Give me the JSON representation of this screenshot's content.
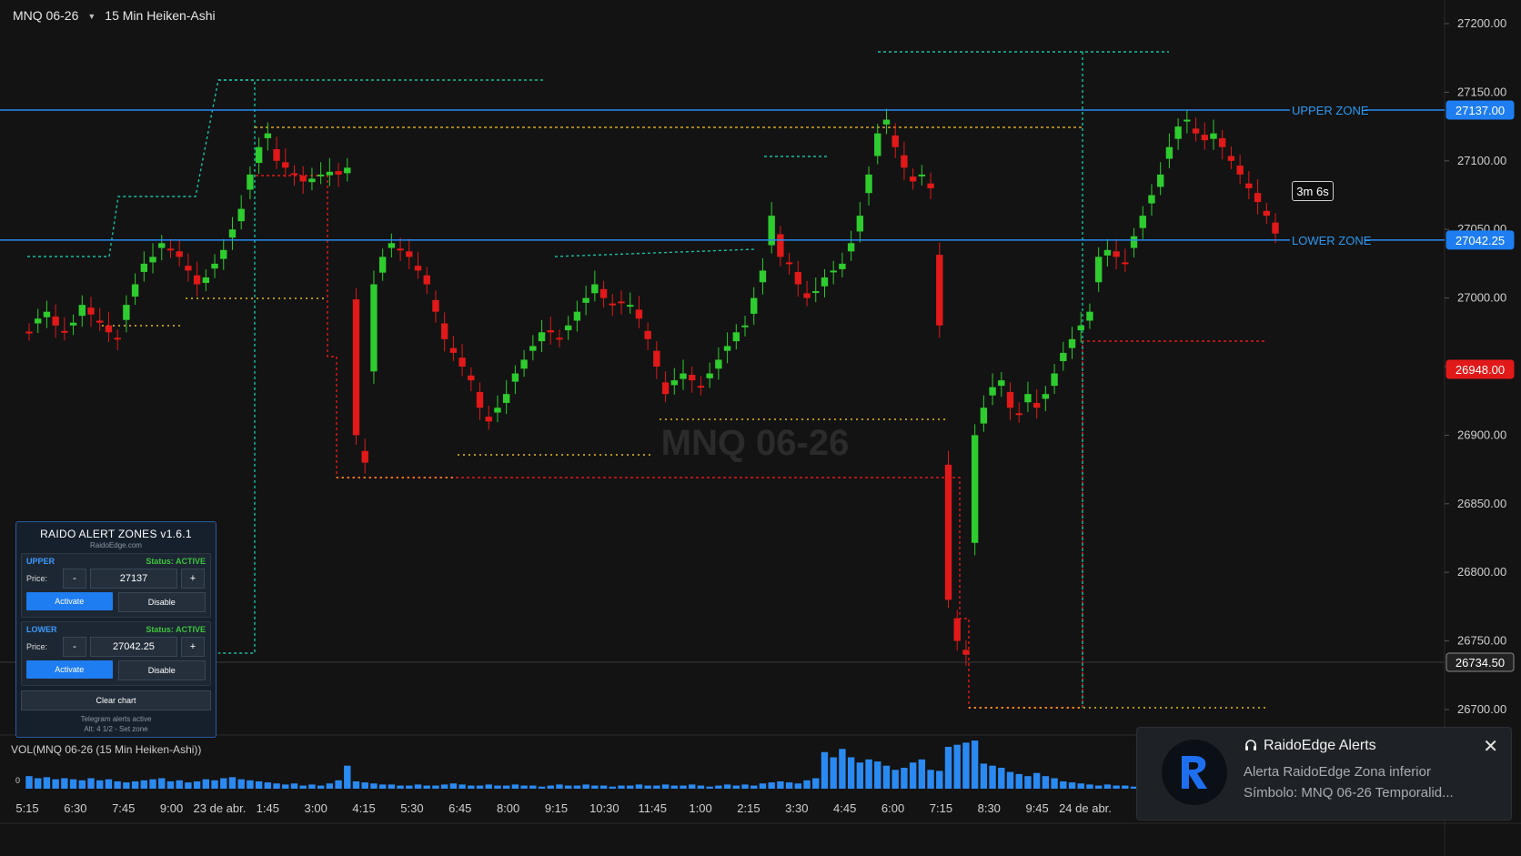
{
  "header": {
    "symbol": "MNQ 06-26",
    "timeframe": "15 Min Heiken-Ashi"
  },
  "watermark": "MNQ 06-26",
  "colors": {
    "bg": "#131313",
    "up": "#2ecc2e",
    "down": "#e11919",
    "zone": "#2a8af2",
    "accent": "#1e7df0"
  },
  "price_axis": {
    "labels": [
      "27200.00",
      "27150.00",
      "27100.00",
      "27050.00",
      "27000.00",
      "26950.00",
      "26900.00",
      "26850.00",
      "26800.00",
      "26750.00",
      "26700.00"
    ],
    "badges": {
      "upper": "27137.00",
      "lower": "27042.25",
      "current": "26948.00",
      "crosshair": "26734.50"
    }
  },
  "zones": {
    "upper_label": "UPPER ZONE",
    "lower_label": "LOWER ZONE"
  },
  "timer": "3m 6s",
  "time_axis": [
    "5:15",
    "6:30",
    "7:45",
    "9:00",
    "23 de abr.",
    "1:45",
    "3:00",
    "4:15",
    "5:30",
    "6:45",
    "8:00",
    "9:15",
    "10:30",
    "11:45",
    "1:00",
    "2:15",
    "3:30",
    "4:45",
    "6:00",
    "7:15",
    "8:30",
    "9:45",
    "24 de abr."
  ],
  "volume": {
    "label": "VOL(MNQ 06-26 (15 Min Heiken-Ashi))",
    "zero": "0"
  },
  "panel": {
    "title": "RAIDO ALERT ZONES  v1.6.1",
    "site": "RaidoEdge.com",
    "upper": {
      "name": "UPPER",
      "status": "Status: ACTIVE",
      "price_label": "Price:",
      "value": "27137",
      "minus": "-",
      "plus": "+",
      "activate": "Activate",
      "disable": "Disable"
    },
    "lower": {
      "name": "LOWER",
      "status": "Status: ACTIVE",
      "price_label": "Price:",
      "value": "27042.25",
      "minus": "-",
      "plus": "+",
      "activate": "Activate",
      "disable": "Disable"
    },
    "clear": "Clear chart",
    "foot1": "Telegram alerts active",
    "foot2": "Alt: 4 1/2 - Set zone"
  },
  "toast": {
    "title": "RaidoEdge Alerts",
    "line1": "Alerta RaidoEdge Zona inferior",
    "line2": "Símbolo: MNQ 06-26 Temporalid..."
  },
  "chart_data": {
    "type": "candlestick",
    "y_range": [
      26680,
      27220
    ],
    "closes": [
      26975,
      26985,
      26990,
      26980,
      26975,
      26982,
      26995,
      26988,
      26982,
      26975,
      26970,
      26995,
      27010,
      27025,
      27030,
      27040,
      27035,
      27030,
      27020,
      27010,
      27015,
      27025,
      27035,
      27050,
      27065,
      27090,
      27110,
      27120,
      27100,
      27095,
      27090,
      27085,
      27087,
      27090,
      27092,
      27090,
      27095,
      26900,
      26880,
      27010,
      27030,
      27040,
      27035,
      27030,
      27020,
      27010,
      26990,
      26970,
      26960,
      26950,
      26940,
      26920,
      26910,
      26920,
      26930,
      26945,
      26955,
      26965,
      26975,
      26975,
      26970,
      26980,
      26990,
      27000,
      27010,
      27000,
      26995,
      26997,
      26995,
      26985,
      26970,
      26950,
      26930,
      26940,
      26945,
      26940,
      26935,
      26945,
      26955,
      26965,
      26975,
      26980,
      27000,
      27020,
      27060,
      27030,
      27025,
      27010,
      27000,
      27005,
      27015,
      27020,
      27025,
      27040,
      27060,
      27090,
      27120,
      27130,
      27110,
      27095,
      27085,
      27090,
      27080,
      26980,
      26780,
      26750,
      26740,
      26900,
      26920,
      26935,
      26940,
      26920,
      26915,
      26930,
      26920,
      26930,
      26945,
      26960,
      26970,
      26980,
      26990,
      27030,
      27035,
      27030,
      27025,
      27045,
      27060,
      27075,
      27090,
      27110,
      27125,
      27130,
      27120,
      27115,
      27120,
      27110,
      27100,
      27090,
      27080,
      27070,
      27060,
      27047
    ],
    "volume": [
      12,
      10,
      11,
      9,
      10,
      9,
      8,
      10,
      8,
      9,
      7,
      6,
      7,
      8,
      9,
      10,
      7,
      8,
      6,
      7,
      9,
      8,
      10,
      11,
      9,
      8,
      7,
      6,
      5,
      4,
      5,
      3,
      4,
      3,
      5,
      8,
      22,
      7,
      6,
      5,
      4,
      4,
      3,
      3,
      4,
      3,
      3,
      4,
      5,
      4,
      3,
      3,
      4,
      3,
      3,
      4,
      3,
      3,
      2,
      3,
      4,
      3,
      3,
      4,
      3,
      3,
      2,
      3,
      3,
      4,
      3,
      3,
      4,
      3,
      3,
      4,
      3,
      2,
      3,
      4,
      3,
      4,
      3,
      5,
      6,
      7,
      6,
      5,
      8,
      10,
      35,
      30,
      38,
      30,
      25,
      28,
      26,
      22,
      18,
      20,
      25,
      28,
      18,
      17,
      40,
      42,
      44,
      46,
      24,
      22,
      20,
      16,
      14,
      12,
      15,
      12,
      10,
      7,
      6,
      5,
      4,
      3,
      4,
      3,
      3,
      2,
      3,
      2,
      3,
      3,
      2,
      3,
      3,
      4,
      3,
      3,
      4,
      3,
      3,
      4,
      3,
      3
    ]
  }
}
